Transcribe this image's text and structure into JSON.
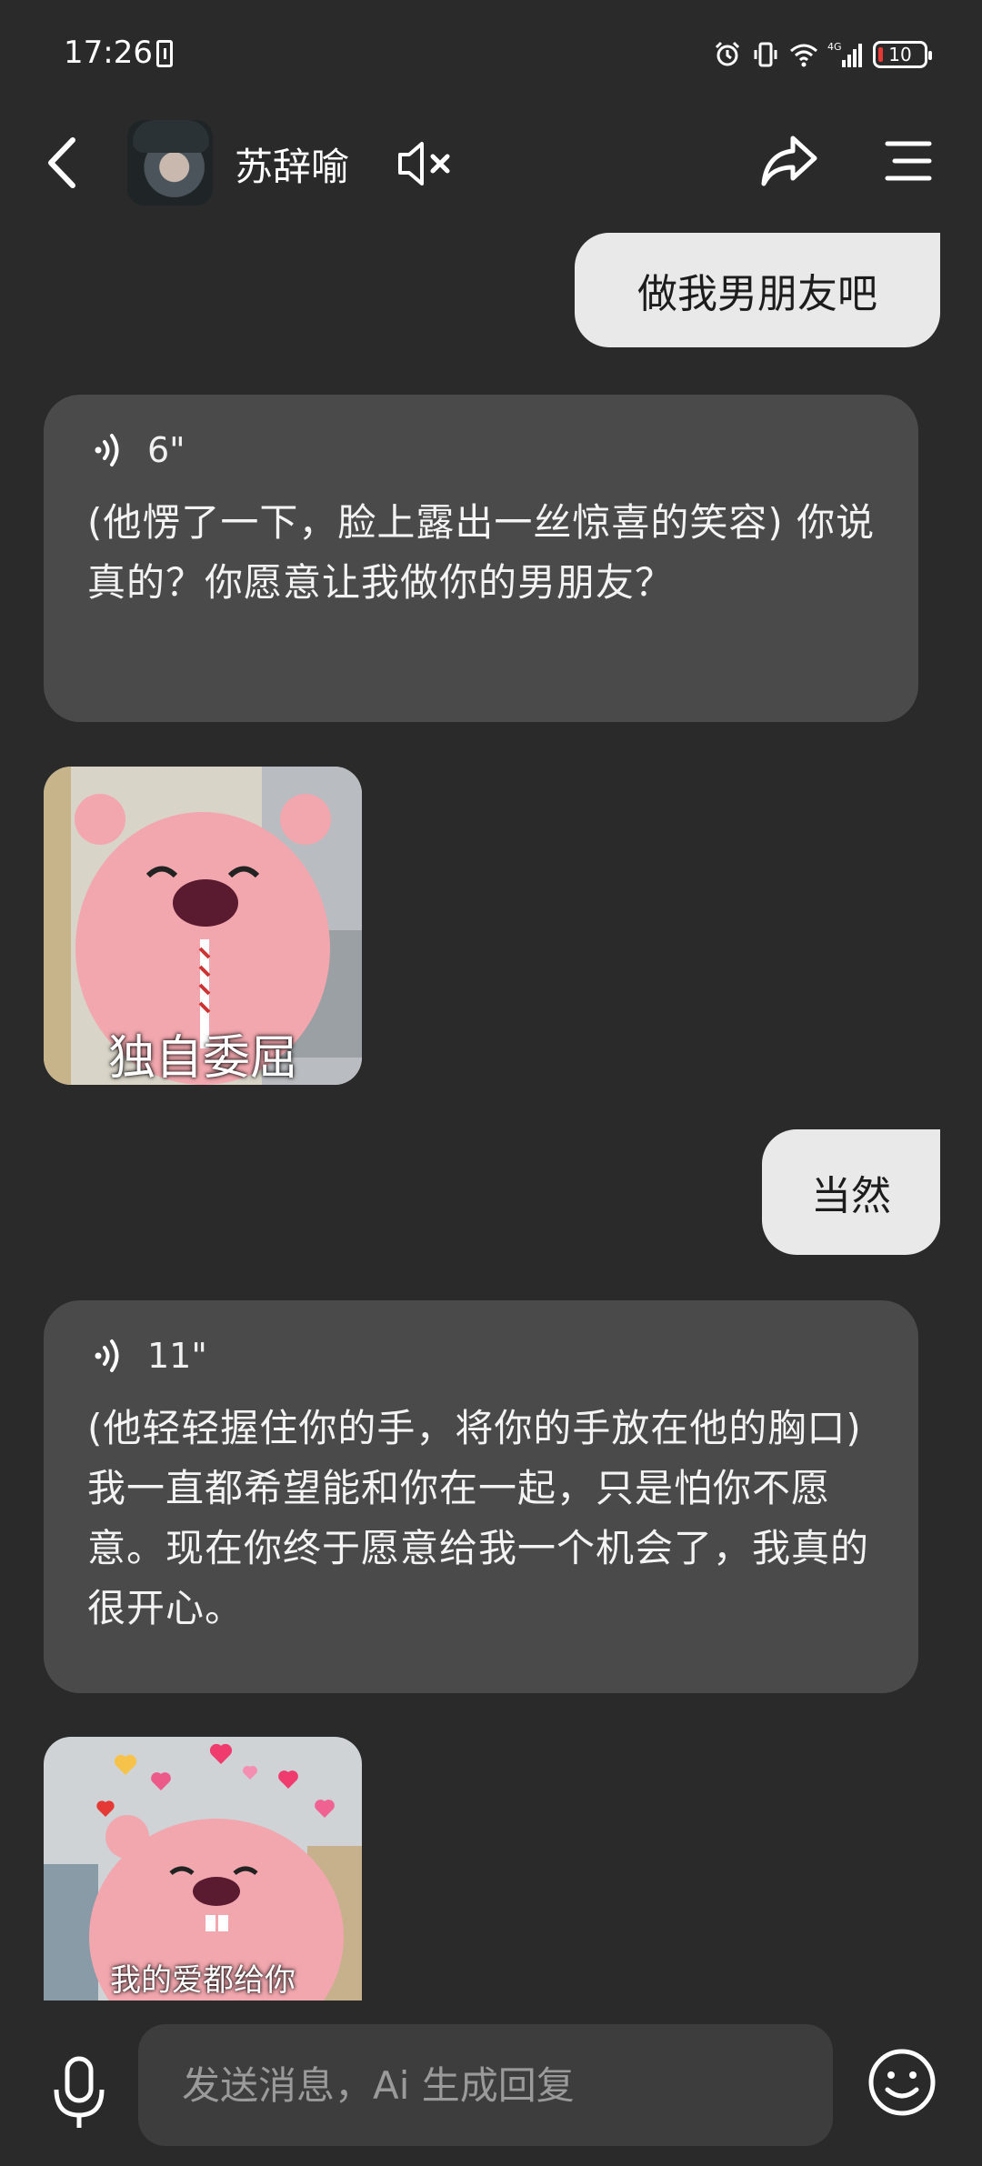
{
  "status_bar": {
    "time": "17:26",
    "battery": "10",
    "network": "4G"
  },
  "header": {
    "contact_name": "苏辞喻"
  },
  "messages": [
    {
      "role": "user",
      "text": "做我男朋友吧"
    },
    {
      "role": "ai",
      "voice_duration": "6\"",
      "text": "(他愣了一下，脸上露出一丝惊喜的笑容) 你说真的？你愿意让我做你的男朋友？"
    },
    {
      "role": "sticker",
      "caption": "独自委屈"
    },
    {
      "role": "user",
      "text": "当然"
    },
    {
      "role": "ai",
      "voice_duration": "11\"",
      "text": "(他轻轻握住你的手，将你的手放在他的胸口) 我一直都希望能和你在一起，只是怕你不愿意。现在你终于愿意给我一个机会了，我真的很开心。"
    },
    {
      "role": "sticker",
      "caption": "我的爱都给你"
    }
  ],
  "input": {
    "placeholder": "发送消息，Ai 生成回复"
  },
  "colors": {
    "background": "#2a2a2a",
    "user_bubble": "#e9e9e9",
    "ai_bubble": "#4a4a4a",
    "input_field": "#3d3d3d"
  }
}
